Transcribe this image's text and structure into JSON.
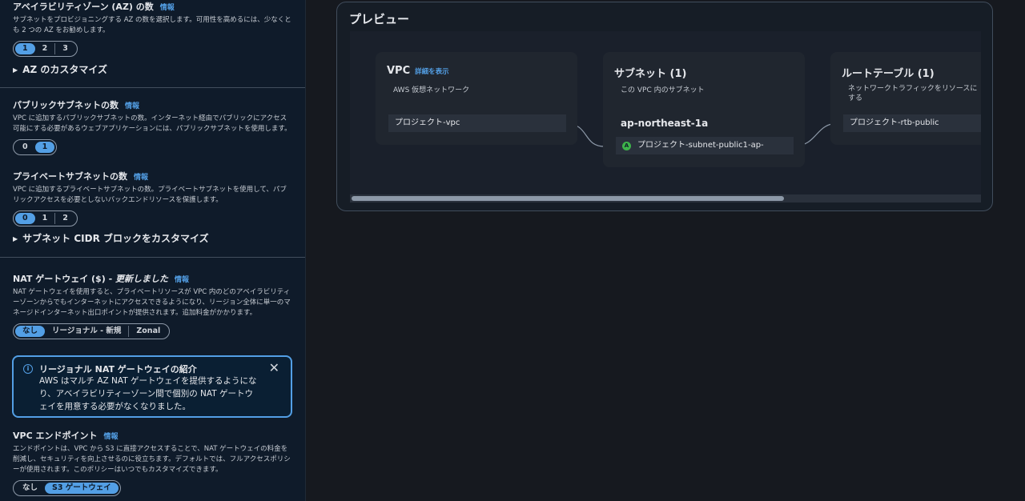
{
  "left": {
    "az": {
      "title": "アベイラビリティゾーン (AZ) の数",
      "info": "情報",
      "desc": "サブネットをプロビジョニングする AZ の数を選択します。可用性を高めるには、少なくとも 2 つの AZ をお勧めします。",
      "options": [
        "1",
        "2",
        "3"
      ],
      "selected": "1",
      "customize": "AZ のカスタマイズ"
    },
    "public_subnets": {
      "title": "パブリックサブネットの数",
      "info": "情報",
      "desc": "VPC に追加するパブリックサブネットの数。インターネット経由でパブリックにアクセス可能にする必要があるウェブアプリケーションには、パブリックサブネットを使用します。",
      "options": [
        "0",
        "1"
      ],
      "selected": "1"
    },
    "private_subnets": {
      "title": "プライベートサブネットの数",
      "info": "情報",
      "desc": "VPC に追加するプライベートサブネットの数。プライベートサブネットを使用して、パブリックアクセスを必要としないバックエンドリソースを保護します。",
      "options": [
        "0",
        "1",
        "2"
      ],
      "selected": "0",
      "customize": "サブネット CIDR ブロックをカスタマイズ"
    },
    "nat": {
      "title": "NAT ゲートウェイ ($) - ",
      "title_em": "更新しました",
      "info": "情報",
      "desc": "NAT ゲートウェイを使用すると、プライベートリソースが VPC 内のどのアベイラビリティーゾーンからでもインターネットにアクセスできるようになり、リージョン全体に単一のマネージドインターネット出口ポイントが提供されます。追加料金がかかります。",
      "options": [
        "なし",
        "リージョナル - 新規",
        "Zonal"
      ],
      "selected": "なし"
    },
    "alert": {
      "icon": "info-icon",
      "title": "リージョナル NAT ゲートウェイの紹介",
      "body": "AWS はマルチ AZ NAT ゲートウェイを提供するようになり、アベイラビリティーゾーン間で個別の NAT ゲートウェイを用意する必要がなくなりました。",
      "close": "✕"
    },
    "endpoints": {
      "title": "VPC エンドポイント",
      "info": "情報",
      "desc": "エンドポイントは、VPC から S3 に直接アクセスすることで、NAT ゲートウェイの料金を削減し、セキュリティを向上させるのに役立ちます。デフォルトでは、フルアクセスポリシーが使用されます。このポリシーはいつでもカスタマイズできます。",
      "options": [
        "なし",
        "S3 ゲートウェイ"
      ],
      "selected": "S3 ゲートウェイ"
    }
  },
  "preview": {
    "title": "プレビュー",
    "vpc": {
      "title": "VPC",
      "link": "詳細を表示",
      "subtitle": "AWS 仮想ネットワーク",
      "item": "プロジェクト-vpc"
    },
    "subnets": {
      "title": "サブネット (1)",
      "subtitle": "この VPC 内のサブネット",
      "az": "ap-northeast-1a",
      "badge": "A",
      "item": "プロジェクト-subnet-public1-ap-"
    },
    "route_tables": {
      "title": "ルートテーブル (1)",
      "subtitle_1": "ネットワークトラフィックをリソースに",
      "subtitle_2": "する",
      "item": "プロジェクト-rtb-public"
    }
  }
}
